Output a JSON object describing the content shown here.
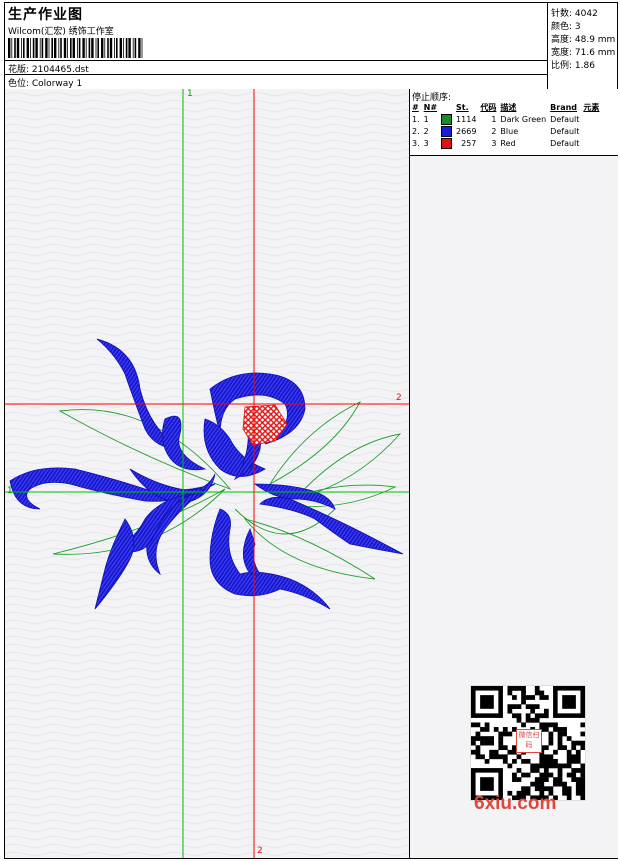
{
  "header": {
    "title": "生产作业图",
    "company": "Wilcom(汇宏) 绣饰工作室",
    "design_label": "花版: 2104465.dst",
    "colorway_label": "色位: Colorway 1"
  },
  "stats": {
    "stitches": "针数: 4042",
    "colors": "颜色: 3",
    "height": "高度: 48.9 mm",
    "width": "宽度: 71.6 mm",
    "scale": "比例: 1.86"
  },
  "stop_sequence": {
    "title": "停止顺序:",
    "headers": [
      "#",
      "N#",
      "St.",
      "代码",
      "描述",
      "Brand",
      "元素"
    ],
    "rows": [
      {
        "idx": "1.",
        "n": "1",
        "color": "#1a8a2a",
        "st": "1114",
        "code": "1",
        "desc": "Dark Green",
        "brand": "Default"
      },
      {
        "idx": "2.",
        "n": "2",
        "color": "#1a1adc",
        "st": "2669",
        "code": "2",
        "desc": "Blue",
        "brand": "Default"
      },
      {
        "idx": "3.",
        "n": "3",
        "color": "#e01010",
        "st": "257",
        "code": "3",
        "desc": "Red",
        "brand": "Default"
      }
    ]
  },
  "axes": {
    "green_label": "1",
    "red_label_right": "2",
    "red_label_bottom": "2",
    "green_left_label": "1"
  },
  "watermark": {
    "site": "6xiu.com",
    "seal": "微信扫码"
  },
  "colors": {
    "green": "#00c000",
    "red": "#ff0000",
    "blue": "#1a1ad8",
    "leaf": "#1f9d2a",
    "watermark_red": "#e0463c"
  }
}
